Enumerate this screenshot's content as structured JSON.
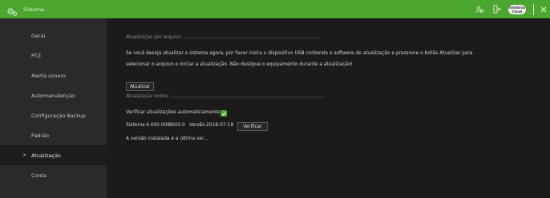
{
  "topbar": {
    "title": "Sistema",
    "brand_icon": "gear-cluster-icon",
    "actions": {
      "user_icon": "users-icon",
      "logout_icon": "logout-icon",
      "cloud_badge_line1": "Intelbras",
      "cloud_badge_line2": "Cloud",
      "close_icon": "close-icon"
    },
    "colors": {
      "accent": "#4aa62e"
    }
  },
  "sidebar": {
    "items": [
      {
        "label": "Geral"
      },
      {
        "label": "PTZ"
      },
      {
        "label": "Alerta sonoro"
      },
      {
        "label": "Automanutenção"
      },
      {
        "label": "Configuração Backup"
      },
      {
        "label": "Padrão"
      },
      {
        "label": "Atualização",
        "active": true
      },
      {
        "label": "Conta"
      }
    ],
    "active_caret": ">"
  },
  "main": {
    "file_update": {
      "section_title": "Atualização por arquivo",
      "line1": "Se você deseja atualizar o sistema agora, por favor insira o dispositivo USB contendo o software de atualização e pressione o botão Atualizar para",
      "line2": "selecionar o arquivo e iniciar a atualização. Não desligue o equipamento durante a atualização!",
      "button": "Atualizar"
    },
    "online_update": {
      "section_title": "Atualização online",
      "auto_check_label": "Verificar atualizações automaticamente.",
      "auto_check_checked": true,
      "system_label": "Sistema",
      "system_value": "4.000.00IB000.0",
      "version_label": "Versão",
      "version_value": "2018-07-18",
      "verify_button": "Verificar",
      "status": "A versão instalada é a última ver..."
    }
  }
}
